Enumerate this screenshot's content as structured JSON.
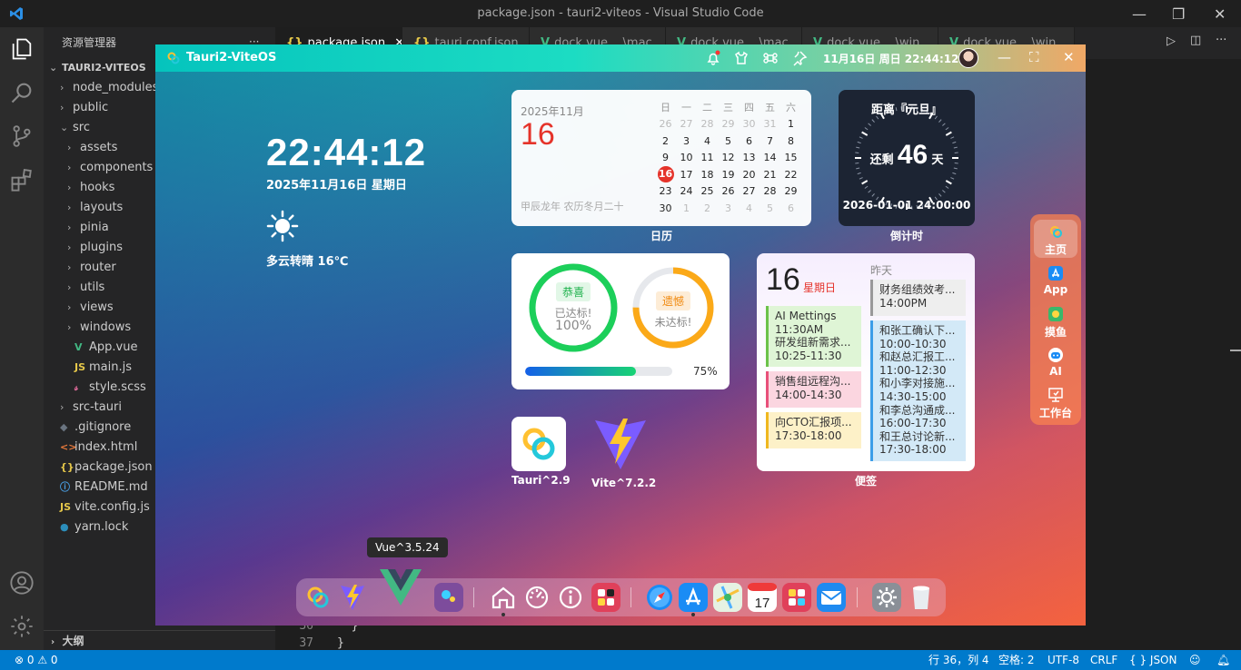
{
  "vscode": {
    "window_title": "package.json - tauri2-viteos - Visual Studio Code",
    "explorer_title": "资源管理器",
    "explorer_more": "···",
    "project": "TAURI2-VITEOS",
    "tree": [
      {
        "label": "node_modules",
        "kind": "folder",
        "depth": 1,
        "open": false
      },
      {
        "label": "public",
        "kind": "folder",
        "depth": 1,
        "open": false
      },
      {
        "label": "src",
        "kind": "folder",
        "depth": 1,
        "open": true
      },
      {
        "label": "assets",
        "kind": "folder",
        "depth": 2,
        "open": false
      },
      {
        "label": "components",
        "kind": "folder",
        "depth": 2,
        "open": false
      },
      {
        "label": "hooks",
        "kind": "folder",
        "depth": 2,
        "open": false
      },
      {
        "label": "layouts",
        "kind": "folder",
        "depth": 2,
        "open": false
      },
      {
        "label": "pinia",
        "kind": "folder",
        "depth": 2,
        "open": false
      },
      {
        "label": "plugins",
        "kind": "folder",
        "depth": 2,
        "open": false
      },
      {
        "label": "router",
        "kind": "folder",
        "depth": 2,
        "open": false
      },
      {
        "label": "utils",
        "kind": "folder",
        "depth": 2,
        "open": false
      },
      {
        "label": "views",
        "kind": "folder",
        "depth": 2,
        "open": false
      },
      {
        "label": "windows",
        "kind": "folder",
        "depth": 2,
        "open": false
      },
      {
        "label": "App.vue",
        "kind": "vue",
        "depth": 2
      },
      {
        "label": "main.js",
        "kind": "js",
        "depth": 2
      },
      {
        "label": "style.scss",
        "kind": "scss",
        "depth": 2
      },
      {
        "label": "src-tauri",
        "kind": "folder",
        "depth": 1,
        "open": false
      },
      {
        "label": ".gitignore",
        "kind": "git",
        "depth": 1
      },
      {
        "label": "index.html",
        "kind": "html",
        "depth": 1
      },
      {
        "label": "package.json",
        "kind": "json",
        "depth": 1
      },
      {
        "label": "README.md",
        "kind": "md",
        "depth": 1
      },
      {
        "label": "vite.config.js",
        "kind": "js",
        "depth": 1
      },
      {
        "label": "yarn.lock",
        "kind": "yarn",
        "depth": 1
      }
    ],
    "outline": "大纲",
    "tabs": [
      "package.json",
      "tauri.conf.json",
      "dock.vue ...\\mac",
      "dock.vue ...\\mac",
      "dock.vue ...\\win",
      "dock.vue ...\\win"
    ],
    "code_lines": [
      {
        "n": "36",
        "text": "  }"
      },
      {
        "n": "37",
        "text": "}"
      }
    ],
    "status": {
      "problems": "⊗ 0 ⚠ 0",
      "position": "行 36，列 4",
      "spaces": "空格: 2",
      "encoding": "UTF-8",
      "eol": "CRLF",
      "lang": "{ } JSON"
    }
  },
  "app": {
    "title": "Tauri2-ViteOS",
    "datetime": "11月16日 周日 22:44:12",
    "clock": "22:44:12",
    "date": "2025年11月16日 星期日",
    "weather": "多云转晴 16℃",
    "calendar": {
      "year_month": "2025年11月",
      "day": "16",
      "lunar": "甲辰龙年 农历冬月二十",
      "label": "日历",
      "headers": [
        "日",
        "一",
        "二",
        "三",
        "四",
        "五",
        "六"
      ],
      "weeks": [
        [
          "26",
          "27",
          "28",
          "29",
          "30",
          "31",
          "1"
        ],
        [
          "2",
          "3",
          "4",
          "5",
          "6",
          "7",
          "8"
        ],
        [
          "9",
          "10",
          "11",
          "12",
          "13",
          "14",
          "15"
        ],
        [
          "16",
          "17",
          "18",
          "19",
          "20",
          "21",
          "22"
        ],
        [
          "23",
          "24",
          "25",
          "26",
          "27",
          "28",
          "29"
        ],
        [
          "30",
          "1",
          "2",
          "3",
          "4",
          "5",
          "6"
        ]
      ],
      "today": "16"
    },
    "countdown": {
      "title": "距离『元旦』",
      "prefix": "还剩",
      "days": "46",
      "unit": "天",
      "end": "2026-01-01 24:00:00",
      "label": "倒计时"
    },
    "goals": {
      "left": {
        "tag": "恭喜",
        "text": "已达标!",
        "value": "100%",
        "fraction": 1.0,
        "color": "#1ccf5a"
      },
      "right": {
        "tag": "遗憾",
        "text": "未达标!",
        "fraction": 0.75,
        "color": "#fba918"
      },
      "progress": 0.75,
      "progress_text": "75%"
    },
    "notes": {
      "day": "16",
      "weekday": "星期日",
      "yesterday": "昨天",
      "label": "便签",
      "left": [
        {
          "lines": [
            "AI Mettings",
            "11:30AM",
            "研发组新需求...",
            "10:25-11:30"
          ],
          "bg": "#dff5d6",
          "bar": "#6cc24a"
        },
        {
          "lines": [
            "销售组远程沟...",
            "14:00-14:30"
          ],
          "bg": "#fbd6e0",
          "bar": "#e8507a"
        },
        {
          "lines": [
            "向CTO汇报项...",
            "17:30-18:00"
          ],
          "bg": "#fdf1c8",
          "bar": "#f0b820"
        }
      ],
      "right": [
        {
          "lines": [
            "财务组绩效考...",
            "14:00PM"
          ],
          "bg": "#eeeeee",
          "bar": "#999999"
        },
        {
          "lines": [
            "和张工确认下...",
            "10:00-10:30",
            "和赵总汇报工...",
            "11:00-12:30",
            "和小李对接施...",
            "14:30-15:00",
            "和李总沟通成...",
            "16:00-17:30",
            "和王总讨论新...",
            "17:30-18:00"
          ],
          "bg": "#d3e9f7",
          "bar": "#3c9ee8"
        }
      ]
    },
    "apps": [
      {
        "label": "Tauri^2.9"
      },
      {
        "label": "Vite^7.2.2"
      }
    ],
    "dock_tooltip": "Vue^3.5.24",
    "sidenav": [
      "主页",
      "App",
      "摸鱼",
      "AI",
      "工作台"
    ]
  }
}
